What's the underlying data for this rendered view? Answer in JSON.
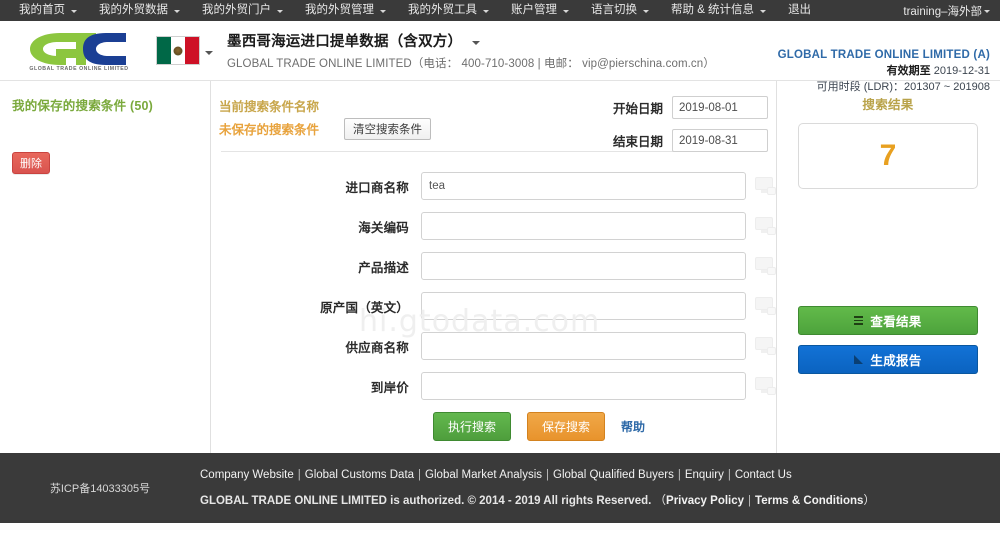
{
  "topnav": {
    "items": [
      {
        "label": "我的首页",
        "has_caret": true
      },
      {
        "label": "我的外贸数据",
        "has_caret": true
      },
      {
        "label": "我的外贸门户",
        "has_caret": true
      },
      {
        "label": "我的外贸管理",
        "has_caret": true
      },
      {
        "label": "我的外贸工具",
        "has_caret": true
      },
      {
        "label": "账户管理",
        "has_caret": true
      },
      {
        "label": "语言切换",
        "has_caret": true
      },
      {
        "label": "帮助 & 统计信息",
        "has_caret": true
      },
      {
        "label": "退出",
        "has_caret": false
      }
    ],
    "user": "training–海外部"
  },
  "header": {
    "logo_subtitle": "GLOBAL TRADE ONLINE LIMITED",
    "flag_country": "Mexico",
    "dataset_title": "墨西哥海运进口提单数据（含双方）",
    "company_line": "GLOBAL TRADE ONLINE LIMITED（电话： 400-710-3008 | 电邮： vip@pierschina.com.cn）",
    "account_name": "GLOBAL TRADE ONLINE LIMITED (A)",
    "validity_label": "有效期至",
    "validity_value": "2019-12-31",
    "ldr_label": "可用时段 (LDR)：",
    "ldr_value": "201307 ~ 201908"
  },
  "sidebar": {
    "saved_title": "我的保存的搜索条件 (50)",
    "delete_button": "删除"
  },
  "search_panel": {
    "current_cond_label": "当前搜索条件名称",
    "unsaved_label": "未保存的搜索条件",
    "clear_button": "清空搜索条件",
    "start_date_label": "开始日期",
    "start_date_value": "2019-08-01",
    "end_date_label": "结束日期",
    "end_date_value": "2019-08-31",
    "watermark": "hi.gtodata.com",
    "fields": [
      {
        "label": "进口商名称",
        "value": "tea",
        "placeholder": ""
      },
      {
        "label": "海关编码",
        "value": "",
        "placeholder": ""
      },
      {
        "label": "产品描述",
        "value": "",
        "placeholder": ""
      },
      {
        "label": "原产国（英文）",
        "value": "",
        "placeholder": ""
      },
      {
        "label": "供应商名称",
        "value": "",
        "placeholder": ""
      },
      {
        "label": "到岸价",
        "value": "",
        "placeholder": ""
      }
    ],
    "execute_button": "执行搜索",
    "save_button": "保存搜索",
    "help_link": "帮助"
  },
  "results": {
    "title": "搜索结果",
    "count": "7",
    "view_results_button": "查看结果",
    "generate_report_button": "生成报告"
  },
  "footer": {
    "icp": "苏ICP备14033305号",
    "links": [
      "Company Website",
      "Global Customs Data",
      "Global Market Analysis",
      "Global Qualified Buyers",
      "Enquiry",
      "Contact Us"
    ],
    "copyright": "GLOBAL TRADE ONLINE LIMITED is authorized. © 2014 - 2019 All rights Reserved.",
    "legal_open": "（",
    "privacy": "Privacy Policy",
    "terms": "Terms & Conditions",
    "legal_close": "）"
  },
  "colors": {
    "nav_bg": "#3a3a3a",
    "green": "#4e9e3c",
    "orange": "#e8932c",
    "blue": "#0b63c0",
    "red": "#d9534f",
    "accent_count": "#e8a020"
  }
}
